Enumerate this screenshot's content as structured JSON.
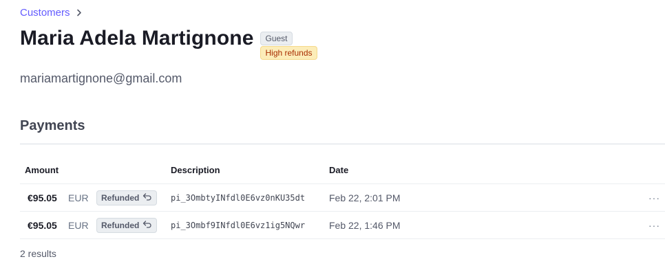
{
  "breadcrumb": {
    "label": "Customers"
  },
  "customer": {
    "name": "Maria Adela Martignone",
    "badges": [
      "Guest",
      "High refunds"
    ],
    "email": "mariamartignone@gmail.com"
  },
  "payments": {
    "title": "Payments",
    "columns": {
      "amount": "Amount",
      "description": "Description",
      "date": "Date"
    },
    "rows": [
      {
        "amount": "€95.05",
        "currency": "EUR",
        "status": "Refunded",
        "description": "pi_3OmbtyINfdl0E6vz0nKU35dt",
        "date": "Feb 22, 2:01 PM",
        "menu": "···"
      },
      {
        "amount": "€95.05",
        "currency": "EUR",
        "status": "Refunded",
        "description": "pi_3Ombf9INfdl0E6vz1ig5NQwr",
        "date": "Feb 22, 1:46 PM",
        "menu": "···"
      }
    ],
    "results": "2 results"
  },
  "colors": {
    "accent": "#635bff",
    "warning_badge_bg": "#fcedb9",
    "warning_badge_text": "#a82c00"
  },
  "icons": {
    "breadcrumb_separator": "chevron-right-icon",
    "refunded": "undo-arrow-icon",
    "row_menu": "more-horizontal-icon"
  }
}
